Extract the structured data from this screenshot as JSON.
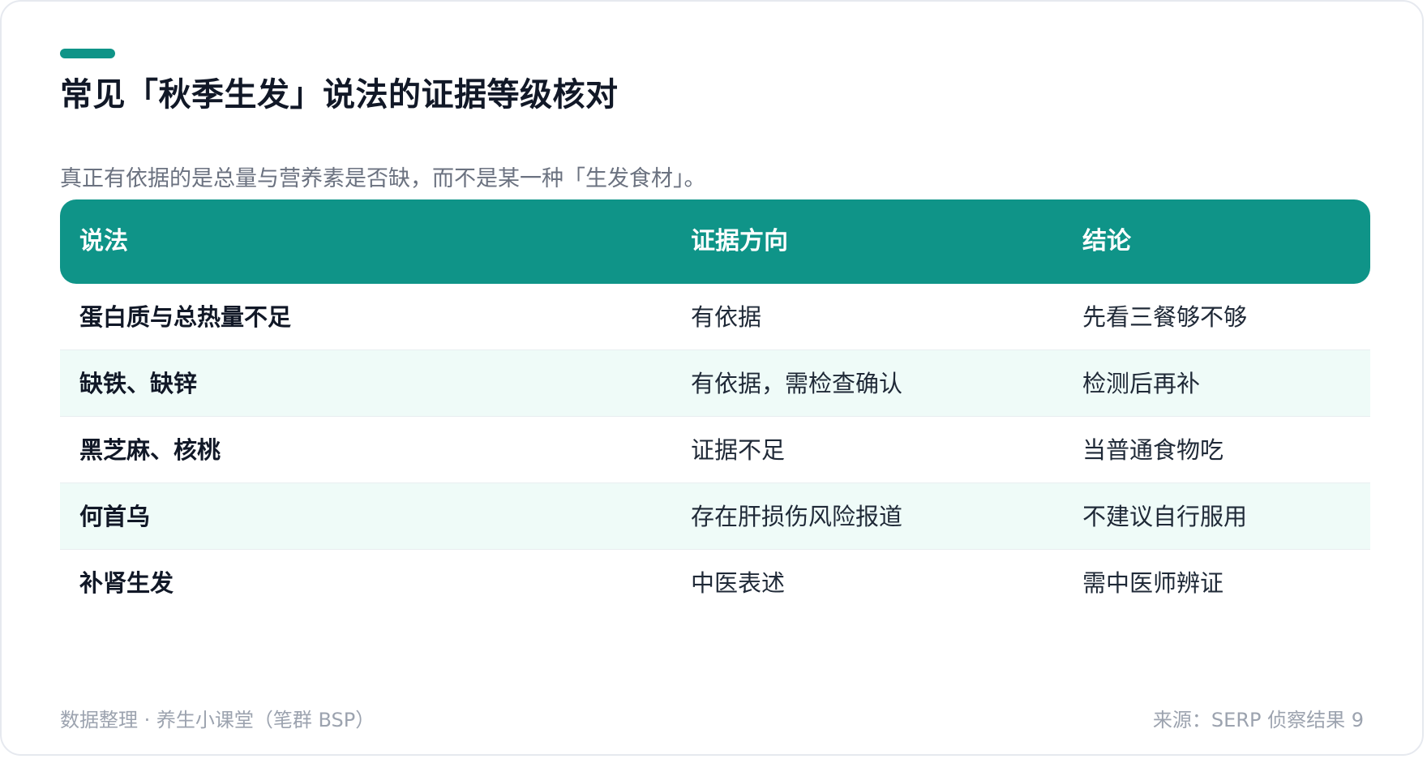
{
  "title": "常见「秋季生发」说法的证据等级核对",
  "subtitle": "真正有依据的是总量与营养素是否缺，而不是某一种「生发食材」。",
  "table": {
    "headers": [
      "说法",
      "证据方向",
      "结论"
    ],
    "rows": [
      {
        "claim": "蛋白质与总热量不足",
        "evidence": "有依据",
        "conclusion": "先看三餐够不够"
      },
      {
        "claim": "缺铁、缺锌",
        "evidence": "有依据，需检查确认",
        "conclusion": "检测后再补"
      },
      {
        "claim": "黑芝麻、核桃",
        "evidence": "证据不足",
        "conclusion": "当普通食物吃"
      },
      {
        "claim": "何首乌",
        "evidence": "存在肝损伤风险报道",
        "conclusion": "不建议自行服用"
      },
      {
        "claim": "补肾生发",
        "evidence": "中医表述",
        "conclusion": "需中医师辨证"
      }
    ]
  },
  "footer": {
    "left": "数据整理 · 养生小课堂（笔群 BSP）",
    "right": "来源：SERP 侦察结果 9"
  },
  "colors": {
    "accent": "#0f9488",
    "row_alt": "#effbf8"
  }
}
